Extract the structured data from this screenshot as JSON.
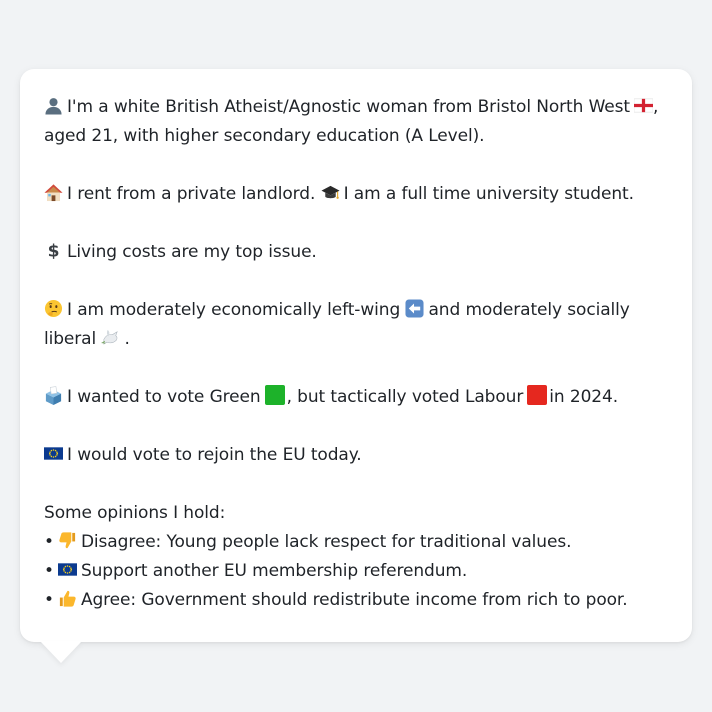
{
  "profile": {
    "p1": {
      "text_a": "I'm a white British Atheist/Agnostic woman from Bristol North West",
      "text_b": ", aged 21, with higher secondary education (A Level)."
    },
    "p2": {
      "text_a": "I rent from a private landlord.",
      "text_b": "I am a full time university student."
    },
    "p3": {
      "text": "Living costs are my top issue."
    },
    "p4": {
      "text_a": "I am moderately economically left-wing",
      "text_b": "and moderately socially liberal",
      "text_c": "."
    },
    "p5": {
      "text_a": "I wanted to vote Green",
      "text_b": ", but tactically voted Labour",
      "text_c": "in 2024."
    },
    "p6": {
      "text": "I would vote to rejoin the EU today."
    },
    "opinions": {
      "heading": "Some opinions I hold:",
      "bullet": "•",
      "items": [
        {
          "icon": "thumbs-down-icon",
          "text": "Disagree: Young people lack respect for traditional values."
        },
        {
          "icon": "eu-flag-icon",
          "text": "Support another EU membership referendum."
        },
        {
          "icon": "thumbs-up-icon",
          "text": "Agree: Government should redistribute income from rich to poor."
        }
      ]
    }
  },
  "colors": {
    "green": "#1db22a",
    "labour_red": "#e5281f",
    "eu_blue": "#0b3a8f"
  }
}
